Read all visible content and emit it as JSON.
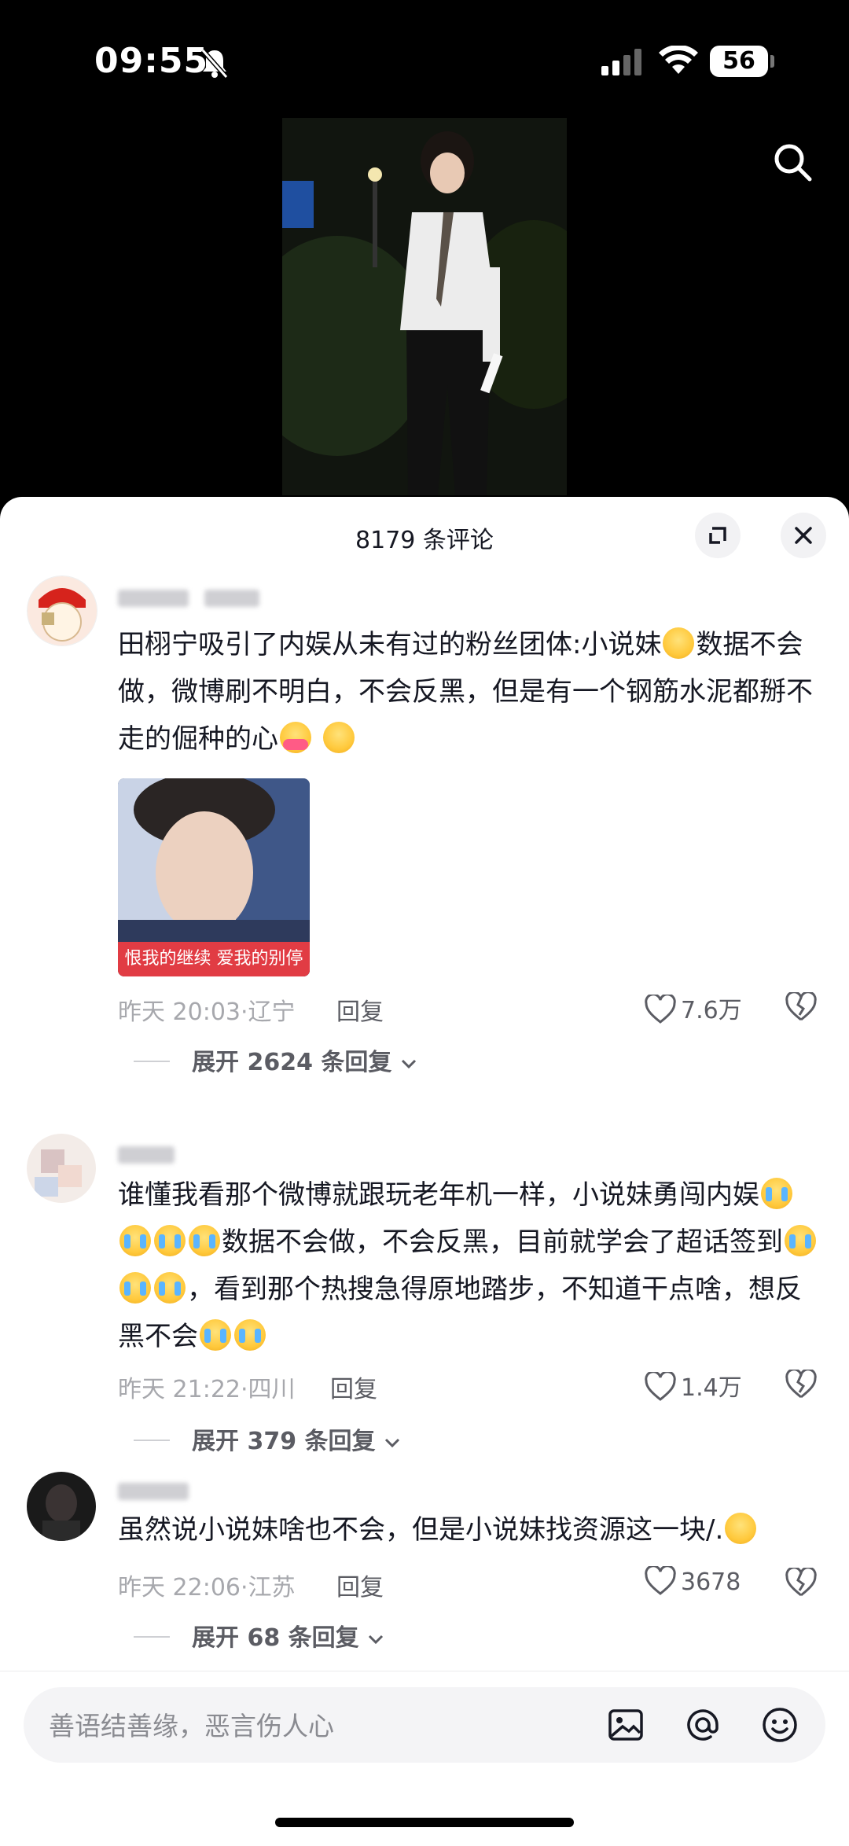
{
  "status_bar": {
    "time": "09:55",
    "battery": "56"
  },
  "sheet": {
    "title": "8179 条评论"
  },
  "comments": [
    {
      "text_a": "田栩宁吸引了内娱从未有过的粉丝团体:小说妹",
      "text_b": "数据不会做，微博刷不明白，不会反黑，但是有一个钢筋水泥都掰不走的倔种的心",
      "image_caption": "恨我的继续 爱我的别停",
      "date": "昨天 20:03",
      "location": "辽宁",
      "reply_label": "回复",
      "likes": "7.6万",
      "expand_label": "展开 2624 条回复"
    },
    {
      "text_a": "谁懂我看那个微博就跟玩老年机一样，小说妹勇闯内娱",
      "text_b": "数据不会做，不会反黑，目前就学会了超话签到",
      "text_c": "，看到那个热搜急得原地踏步，不知道干点啥，想反黑不会",
      "date": "昨天 21:22",
      "location": "四川",
      "reply_label": "回复",
      "likes": "1.4万",
      "expand_label": "展开 379 条回复"
    },
    {
      "text_a": "虽然说小说妹啥也不会，但是小说妹找资源这一块/.",
      "date": "昨天 22:06",
      "location": "江苏",
      "reply_label": "回复",
      "likes": "3678",
      "expand_label": "展开 68 条回复"
    }
  ],
  "input": {
    "placeholder": "善语结善缘，恶言伤人心"
  },
  "icons": [
    "search-icon",
    "expand-icon",
    "close-icon",
    "heart-icon",
    "broken-heart-icon",
    "image-icon",
    "at-icon",
    "emoji-icon"
  ]
}
